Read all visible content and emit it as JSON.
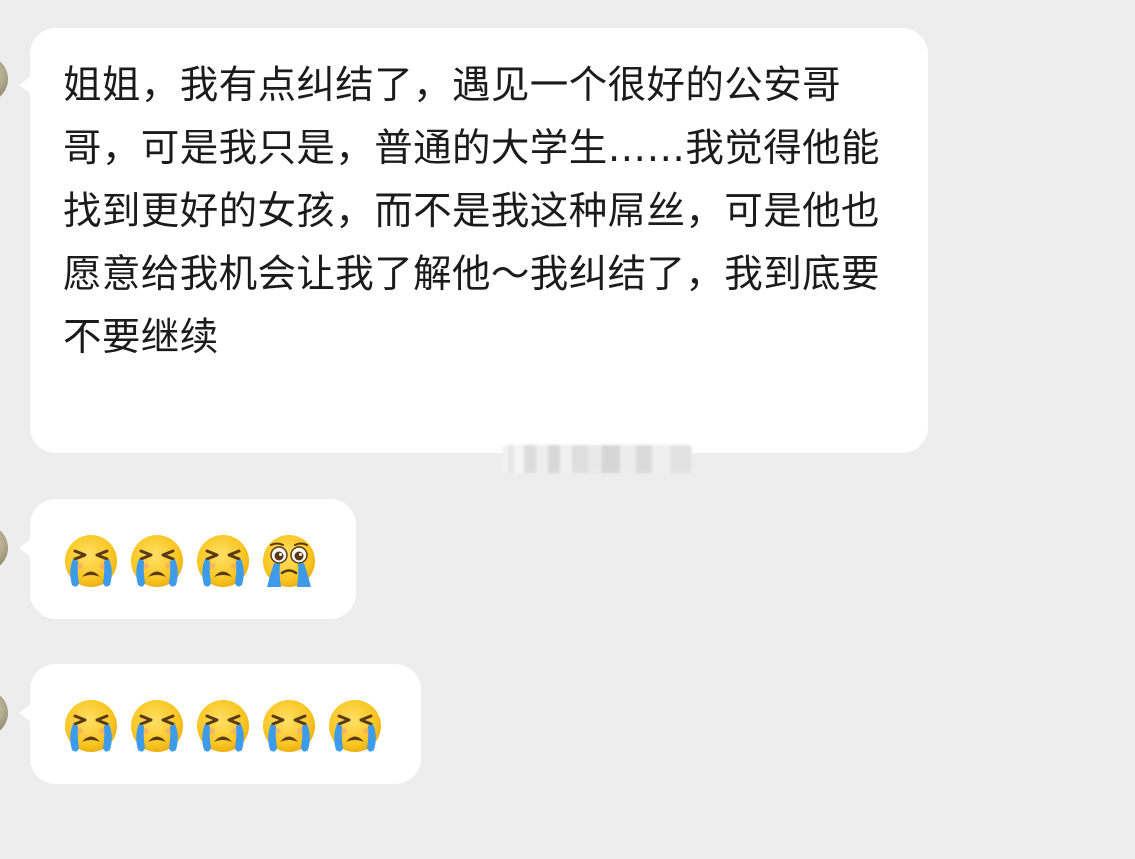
{
  "messages": [
    {
      "type": "text",
      "text": "姐姐，我有点纠结了，遇见一个很好的公安哥哥，可是我只是，普通的大学生……我觉得他能找到更好的女孩，而不是我这种屌丝，可是他也愿意给我机会让我了解他～我纠结了，我到底要不要继续"
    },
    {
      "type": "emoji",
      "emojis": [
        "crying-face",
        "crying-face",
        "crying-face",
        "pleading-tears-face"
      ]
    },
    {
      "type": "emoji",
      "emojis": [
        "crying-face",
        "crying-face",
        "crying-face",
        "crying-face",
        "crying-face"
      ]
    }
  ],
  "colors": {
    "background": "#ededed",
    "bubble": "#ffffff",
    "text": "#1b1b1b",
    "emoji_face": "#f9c623",
    "tears": "#3d9bea"
  }
}
